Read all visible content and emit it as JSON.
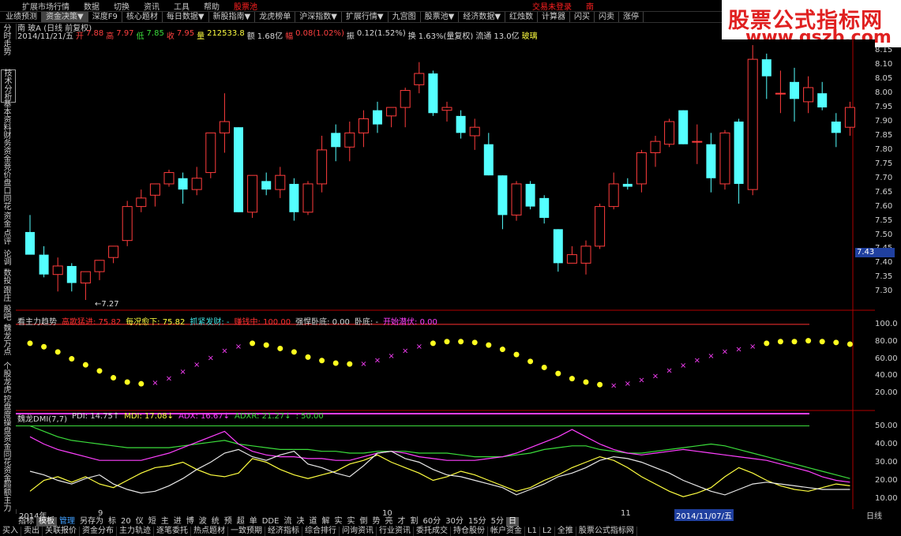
{
  "menu": {
    "items": [
      "扩展市场行情",
      "数据",
      "切换",
      "资讯",
      "工具",
      "帮助"
    ],
    "pool": "股票池",
    "login": "交易未登录",
    "south": "南"
  },
  "toolbar": {
    "items": [
      "业绩预测",
      "资金决策▼",
      "深度F9",
      "核心题材",
      "每日数据▼",
      "新股指南▼",
      "龙虎榜单",
      "沪深指数▼",
      "扩展行情▼",
      "九宫图",
      "股票池▼",
      "经济数据▼",
      "红烛数",
      "计算器",
      "闪买",
      "闪卖",
      "涨停"
    ],
    "selected": 1
  },
  "logo": {
    "line1": "股票公式指标网",
    "line2": "www.gszb.com"
  },
  "title": "南  玻A (日线 前复权)",
  "info": {
    "date": "2014/11/21/五",
    "open_label": "开",
    "open": "7.88",
    "high_label": "高",
    "high": "7.97",
    "low_label": "低",
    "low": "7.85",
    "close_label": "收",
    "close": "7.95",
    "vol_label": "量",
    "vol": "212533.8",
    "amount_label": "额",
    "amount": "1.68亿",
    "chg_label": "幅",
    "chg": "0.08(1.02%)",
    "amp_label": "振",
    "amp": "0.12(1.52%)",
    "turn_label": "换",
    "turn": "1.63%(量复权)",
    "float_label": "流通",
    "float": "13.0亿",
    "sector": "玻璃"
  },
  "sidebar": [
    "分时走势",
    "技术分析",
    "基本资料",
    "财务资金",
    "竞价盘口",
    "同花",
    "资金",
    "点评",
    "论调",
    "数投",
    "跟庄",
    "股吧",
    "魏龙",
    "万点",
    "个股龙虎",
    "控盘度",
    "操盘资金",
    "同花资金",
    "超额主力"
  ],
  "price_axis": [
    "8.15",
    "8.10",
    "8.05",
    "8.00",
    "7.95",
    "7.90",
    "7.85",
    "7.80",
    "7.75",
    "7.70",
    "7.65",
    "7.60",
    "7.55",
    "7.50",
    "7.45",
    "7.40",
    "7.35",
    "7.30"
  ],
  "current_price": "7.43",
  "low_marker": "7.27",
  "sub1": {
    "name": "看主力趋势",
    "items": [
      {
        "label": "高歌猛进: 75.82",
        "color": "#ff3030"
      },
      {
        "label": "每况愈下: 75.82",
        "color": "#ffff40"
      },
      {
        "label": "抓紧发财: -",
        "color": "#40e0e0"
      },
      {
        "label": "赚钱中: 100.00",
        "color": "#ff3030"
      },
      {
        "label": "强悍卧底: 0.00",
        "color": "#d8d8d8"
      },
      {
        "label": "卧底: -",
        "color": "#d8d8d8"
      },
      {
        "label": "开始潜伏: 0.00",
        "color": "#ff40ff"
      }
    ],
    "axis": [
      "100.0",
      "80.00",
      "60.00",
      "40.00",
      "20.00"
    ]
  },
  "sub2": {
    "name": "魏龙DMI(7,7)",
    "items": [
      {
        "label": "PDI: 14.75↑",
        "color": "#d8d8d8"
      },
      {
        "label": "MDI: 17.08↓",
        "color": "#ffff40"
      },
      {
        "label": "ADX: 16.67↓",
        "color": "#ff40ff"
      },
      {
        "label": "ADXR: 21.27↓",
        "color": "#3bdc3b"
      },
      {
        "label": ": 50.00",
        "color": "#3bdc3b"
      }
    ],
    "axis": [
      "50.00",
      "40.00",
      "30.00",
      "20.00",
      "10.00"
    ]
  },
  "datebar": {
    "y2014": "2014年",
    "m9": "9",
    "m10": "10",
    "m11": "11",
    "sel": "2014/11/07/五",
    "period": "日线"
  },
  "bottom_tabs": [
    "指标",
    "模板",
    "管理",
    "另存为",
    "标",
    "20",
    "仪",
    "短",
    "主",
    "进",
    "博",
    "波",
    "统",
    "预",
    "超",
    "单",
    "DDE",
    "流",
    "决",
    "道",
    "解",
    "实",
    "实",
    "倒",
    "势",
    "亮",
    "才",
    "割",
    "60分",
    "30分",
    "15分",
    "5分",
    "日"
  ],
  "status": [
    "买入",
    "卖出",
    "关联报价",
    "资金分布",
    "主力轨迹",
    "逐笔委托",
    "热点题材",
    "一致预期",
    "经济指标",
    "综合排行",
    "问询资讯",
    "行业资讯",
    "委托成交",
    "持仓股份",
    "帐户资金",
    "L1",
    "L2",
    "全推",
    "股票公式指标网"
  ],
  "chart_data": {
    "type": "candlestick",
    "ylim": [
      7.27,
      8.19
    ],
    "candles": [
      {
        "o": 7.51,
        "h": 7.57,
        "l": 7.45,
        "c": 7.43
      },
      {
        "o": 7.43,
        "h": 7.46,
        "l": 7.35,
        "c": 7.36
      },
      {
        "o": 7.36,
        "h": 7.42,
        "l": 7.3,
        "c": 7.39
      },
      {
        "o": 7.39,
        "h": 7.4,
        "l": 7.3,
        "c": 7.33
      },
      {
        "o": 7.33,
        "h": 7.37,
        "l": 7.27,
        "c": 7.37
      },
      {
        "o": 7.37,
        "h": 7.41,
        "l": 7.34,
        "c": 7.41
      },
      {
        "o": 7.42,
        "h": 7.46,
        "l": 7.4,
        "c": 7.46
      },
      {
        "o": 7.48,
        "h": 7.62,
        "l": 7.46,
        "c": 7.6
      },
      {
        "o": 7.6,
        "h": 7.66,
        "l": 7.58,
        "c": 7.63
      },
      {
        "o": 7.64,
        "h": 7.68,
        "l": 7.6,
        "c": 7.68
      },
      {
        "o": 7.68,
        "h": 7.73,
        "l": 7.67,
        "c": 7.72
      },
      {
        "o": 7.7,
        "h": 7.72,
        "l": 7.61,
        "c": 7.66
      },
      {
        "o": 7.66,
        "h": 7.74,
        "l": 7.64,
        "c": 7.7
      },
      {
        "o": 7.72,
        "h": 7.85,
        "l": 7.7,
        "c": 7.86
      },
      {
        "o": 7.86,
        "h": 8.0,
        "l": 7.79,
        "c": 7.9
      },
      {
        "o": 7.88,
        "h": 7.88,
        "l": 7.58,
        "c": 7.58
      },
      {
        "o": 7.58,
        "h": 7.7,
        "l": 7.56,
        "c": 7.71
      },
      {
        "o": 7.69,
        "h": 7.72,
        "l": 7.64,
        "c": 7.66
      },
      {
        "o": 7.66,
        "h": 7.74,
        "l": 7.63,
        "c": 7.71
      },
      {
        "o": 7.68,
        "h": 7.7,
        "l": 7.55,
        "c": 7.58
      },
      {
        "o": 7.58,
        "h": 7.69,
        "l": 7.57,
        "c": 7.68
      },
      {
        "o": 7.68,
        "h": 7.85,
        "l": 7.65,
        "c": 7.8
      },
      {
        "o": 7.86,
        "h": 7.89,
        "l": 7.76,
        "c": 7.81
      },
      {
        "o": 7.81,
        "h": 7.9,
        "l": 7.76,
        "c": 7.86
      },
      {
        "o": 7.86,
        "h": 7.94,
        "l": 7.81,
        "c": 7.91
      },
      {
        "o": 7.94,
        "h": 7.97,
        "l": 7.86,
        "c": 7.89
      },
      {
        "o": 7.92,
        "h": 7.95,
        "l": 7.88,
        "c": 7.95
      },
      {
        "o": 7.95,
        "h": 8.02,
        "l": 7.88,
        "c": 8.01
      },
      {
        "o": 8.03,
        "h": 8.11,
        "l": 8.0,
        "c": 8.07
      },
      {
        "o": 8.07,
        "h": 8.08,
        "l": 7.92,
        "c": 7.93
      },
      {
        "o": 7.94,
        "h": 7.97,
        "l": 7.9,
        "c": 7.95
      },
      {
        "o": 7.92,
        "h": 7.94,
        "l": 7.84,
        "c": 7.86
      },
      {
        "o": 7.85,
        "h": 7.91,
        "l": 7.8,
        "c": 7.88
      },
      {
        "o": 7.82,
        "h": 7.86,
        "l": 7.71,
        "c": 7.71
      },
      {
        "o": 7.71,
        "h": 7.71,
        "l": 7.52,
        "c": 7.57
      },
      {
        "o": 7.57,
        "h": 7.69,
        "l": 7.55,
        "c": 7.68
      },
      {
        "o": 7.68,
        "h": 7.69,
        "l": 7.59,
        "c": 7.6
      },
      {
        "o": 7.63,
        "h": 7.64,
        "l": 7.54,
        "c": 7.56
      },
      {
        "o": 7.52,
        "h": 7.52,
        "l": 7.37,
        "c": 7.4
      },
      {
        "o": 7.4,
        "h": 7.46,
        "l": 7.4,
        "c": 7.43
      },
      {
        "o": 7.4,
        "h": 7.48,
        "l": 7.36,
        "c": 7.46
      },
      {
        "o": 7.46,
        "h": 7.61,
        "l": 7.45,
        "c": 7.6
      },
      {
        "o": 7.6,
        "h": 7.72,
        "l": 7.59,
        "c": 7.68
      },
      {
        "o": 7.68,
        "h": 7.7,
        "l": 7.66,
        "c": 7.67
      },
      {
        "o": 7.68,
        "h": 7.8,
        "l": 7.65,
        "c": 7.79
      },
      {
        "o": 7.79,
        "h": 7.85,
        "l": 7.74,
        "c": 7.83
      },
      {
        "o": 7.82,
        "h": 7.91,
        "l": 7.81,
        "c": 7.9
      },
      {
        "o": 7.94,
        "h": 7.94,
        "l": 7.82,
        "c": 7.82
      },
      {
        "o": 7.83,
        "h": 7.89,
        "l": 7.75,
        "c": 7.83
      },
      {
        "o": 7.82,
        "h": 7.86,
        "l": 7.65,
        "c": 7.7
      },
      {
        "o": 7.68,
        "h": 7.87,
        "l": 7.66,
        "c": 7.86
      },
      {
        "o": 7.9,
        "h": 7.91,
        "l": 7.61,
        "c": 7.68
      },
      {
        "o": 7.66,
        "h": 8.17,
        "l": 7.64,
        "c": 8.12
      },
      {
        "o": 8.12,
        "h": 8.14,
        "l": 7.98,
        "c": 8.06
      },
      {
        "o": 8.0,
        "h": 8.08,
        "l": 7.93,
        "c": 8.0
      },
      {
        "o": 8.04,
        "h": 8.09,
        "l": 7.9,
        "c": 7.98
      },
      {
        "o": 7.97,
        "h": 8.06,
        "l": 7.93,
        "c": 8.02
      },
      {
        "o": 8.0,
        "h": 8.04,
        "l": 7.94,
        "c": 7.95
      },
      {
        "o": 7.9,
        "h": 7.93,
        "l": 7.81,
        "c": 7.86
      },
      {
        "o": 7.88,
        "h": 7.97,
        "l": 7.85,
        "c": 7.95
      }
    ],
    "trend": [
      78,
      74,
      68,
      60,
      53,
      46,
      38,
      33,
      31,
      33,
      38,
      46,
      54,
      62,
      70,
      75,
      78,
      76,
      72,
      68,
      62,
      58,
      55,
      54,
      55,
      59,
      64,
      70,
      75,
      78,
      80,
      80,
      79,
      76,
      71,
      65,
      57,
      50,
      43,
      37,
      33,
      30,
      30,
      32,
      36,
      41,
      47,
      53,
      59,
      64,
      69,
      72,
      75,
      78,
      80,
      80,
      81,
      80,
      79,
      77
    ],
    "pdi": [
      25,
      23,
      20,
      18,
      21,
      23,
      18,
      15,
      13,
      14,
      17,
      21,
      26,
      30,
      35,
      37,
      33,
      31,
      34,
      36,
      29,
      27,
      24,
      22,
      28,
      35,
      36,
      32,
      30,
      26,
      23,
      22,
      20,
      18,
      16,
      12,
      15,
      18,
      22,
      24,
      27,
      31,
      33,
      32,
      30,
      27,
      24,
      20,
      17,
      14,
      12,
      15,
      18,
      19,
      18,
      17,
      16,
      15,
      15,
      15
    ],
    "mdi": [
      14,
      20,
      22,
      19,
      22,
      18,
      16,
      20,
      24,
      27,
      28,
      30,
      26,
      23,
      22,
      24,
      32,
      30,
      26,
      23,
      21,
      23,
      25,
      29,
      31,
      34,
      30,
      27,
      24,
      20,
      22,
      25,
      23,
      20,
      17,
      14,
      16,
      20,
      23,
      27,
      30,
      33,
      31,
      27,
      22,
      18,
      14,
      11,
      13,
      16,
      22,
      27,
      24,
      20,
      17,
      15,
      14,
      16,
      18,
      17
    ],
    "adx": [
      44,
      40,
      37,
      35,
      33,
      31,
      31,
      31,
      31,
      33,
      35,
      38,
      41,
      44,
      47,
      40,
      36,
      34,
      33,
      33,
      32,
      32,
      31,
      31,
      33,
      35,
      36,
      35,
      33,
      32,
      31,
      31,
      31,
      32,
      33,
      35,
      38,
      41,
      44,
      48,
      44,
      40,
      37,
      35,
      34,
      35,
      36,
      37,
      36,
      35,
      34,
      33,
      32,
      31,
      29,
      27,
      25,
      22,
      20,
      19
    ],
    "adxr": [
      50,
      47,
      44,
      42,
      41,
      40,
      39,
      38,
      38,
      38,
      38,
      39,
      40,
      41,
      42,
      40,
      39,
      38,
      37,
      37,
      37,
      36,
      36,
      35,
      35,
      36,
      36,
      36,
      35,
      35,
      35,
      34,
      33,
      33,
      33,
      34,
      35,
      37,
      38,
      39,
      39,
      37,
      36,
      35,
      35,
      36,
      37,
      38,
      39,
      40,
      39,
      37,
      35,
      33,
      31,
      29,
      27,
      25,
      23,
      21
    ],
    "ref50": 50
  }
}
